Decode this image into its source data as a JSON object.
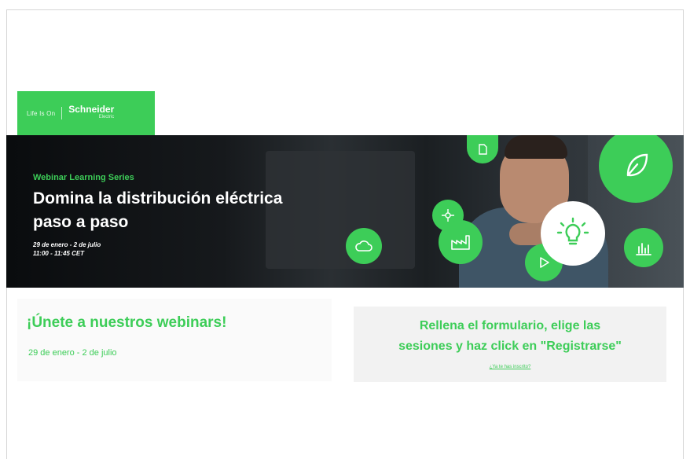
{
  "brand": {
    "tagline": "Life Is On",
    "name": "Schneider",
    "sub": "Electric",
    "color": "#3dcd58"
  },
  "hero": {
    "series": "Webinar Learning Series",
    "title_line1": "Domina la distribución eléctrica",
    "title_line2": "paso a paso",
    "date_range": "29 de enero - 2 de julio",
    "time_range": "11:00 - 11:45 CET",
    "icons": [
      "document-icon",
      "leaf-icon",
      "network-icon",
      "factory-icon",
      "cloud-sync-icon",
      "play-icon",
      "lightbulb-icon",
      "bar-chart-icon"
    ]
  },
  "join": {
    "title": "¡Únete a nuestros webinars!",
    "dates": "29 de enero - 2 de julio"
  },
  "form": {
    "line1": "Rellena el formulario, elige las",
    "line2": "sesiones y haz click en \"Registrarse\"",
    "link": "¿Ya te has inscrito?"
  }
}
